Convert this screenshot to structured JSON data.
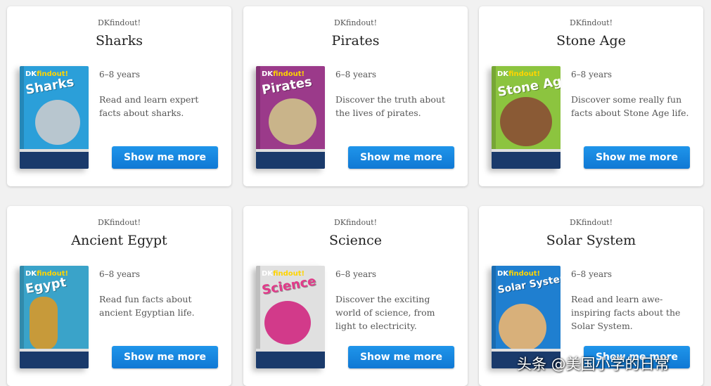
{
  "cards": [
    {
      "brand": "DKfindout!",
      "title": "Sharks",
      "age": "6–8 years",
      "description": "Read and learn expert facts about sharks.",
      "button": "Show me more",
      "cover_title": "Sharks",
      "cover_color": "#2b9fd9",
      "art_color": "#b8c6cf"
    },
    {
      "brand": "DKfindout!",
      "title": "Pirates",
      "age": "6–8 years",
      "description": "Discover the truth about the lives of pirates.",
      "button": "Show me more",
      "cover_title": "Pirates",
      "cover_color": "#9b3a8a",
      "art_color": "#c9b48a"
    },
    {
      "brand": "DKfindout!",
      "title": "Stone Age",
      "age": "6–8 years",
      "description": "Discover some really fun facts about Stone Age life.",
      "button": "Show me more",
      "cover_title": "Stone Age",
      "cover_color": "#8cc43f",
      "art_color": "#8a5a35"
    },
    {
      "brand": "DKfindout!",
      "title": "Ancient Egypt",
      "age": "6–8 years",
      "description": "Read fun facts about ancient Egyptian life.",
      "button": "Show me more",
      "cover_title": "Egypt",
      "cover_color": "#3aa3c9",
      "art_color": "#c79a3a"
    },
    {
      "brand": "DKfindout!",
      "title": "Science",
      "age": "6–8 years",
      "description": "Discover the exciting world of science, from light to electricity.",
      "button": "Show me more",
      "cover_title": "Science",
      "cover_color": "#e0e0e0",
      "art_color": "#d23a8a"
    },
    {
      "brand": "DKfindout!",
      "title": "Solar System",
      "age": "6–8 years",
      "description": "Read and learn awe-inspiring facts about the Solar System.",
      "button": "Show me more",
      "cover_title": "Solar System",
      "cover_color": "#1f7fd0",
      "art_color": "#d8b07a"
    }
  ],
  "cover_logo_prefix": "DK",
  "cover_logo_suffix": "findout!",
  "watermark": "头条 @美国小学的日常"
}
